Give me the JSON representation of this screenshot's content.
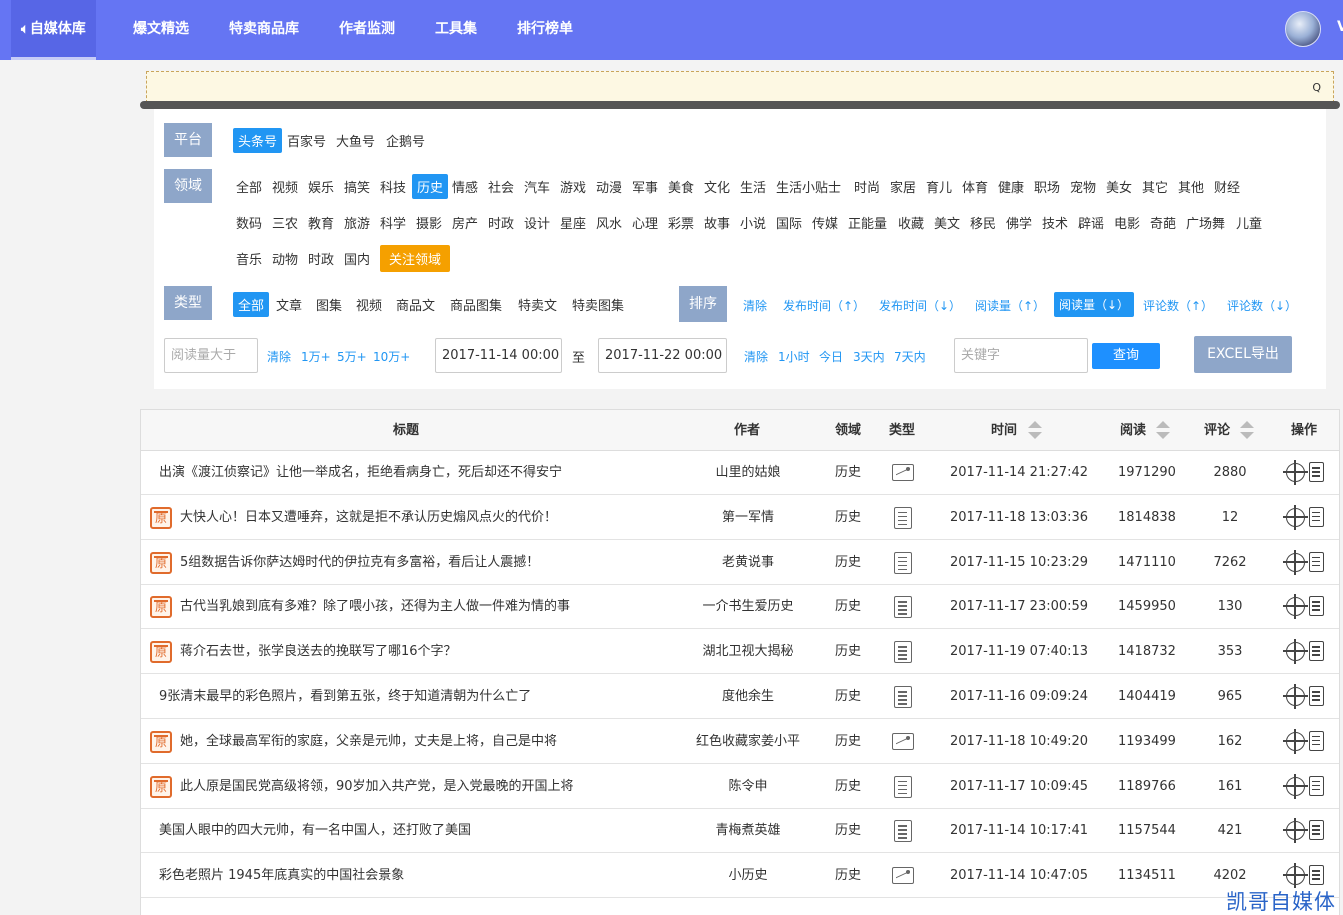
{
  "nav": {
    "brand_icon": "speaker-icon",
    "items": [
      "自媒体库",
      "爆文精选",
      "特卖商品库",
      "作者监测",
      "工具集",
      "排行榜单"
    ],
    "user_initial": "V"
  },
  "filters": {
    "platform_label": "平台",
    "platforms": [
      "头条号",
      "百家号",
      "大鱼号",
      "企鹅号"
    ],
    "domain_label": "领域",
    "domains_row1": [
      "全部",
      "视频",
      "娱乐",
      "搞笑",
      "科技",
      "历史",
      "情感",
      "社会",
      "汽车",
      "游戏",
      "动漫",
      "军事",
      "美食",
      "文化",
      "生活",
      "生活小贴士",
      "时尚",
      "家居",
      "育儿",
      "体育",
      "健康",
      "职场",
      "宠物",
      "美女",
      "其它",
      "其他",
      "财经"
    ],
    "domains_row2": [
      "数码",
      "三农",
      "教育",
      "旅游",
      "科学",
      "摄影",
      "房产",
      "时政",
      "设计",
      "星座",
      "风水",
      "心理",
      "彩票",
      "故事",
      "小说",
      "国际",
      "传媒",
      "正能量",
      "收藏",
      "美文",
      "移民",
      "佛学",
      "技术",
      "辟谣",
      "电影",
      "奇葩",
      "广场舞",
      "儿童"
    ],
    "domains_row3": [
      "音乐",
      "动物",
      "时政",
      "国内"
    ],
    "follow_domain": "关注领域",
    "type_label": "类型",
    "types": [
      "全部",
      "文章",
      "图集",
      "视频",
      "商品文",
      "商品图集",
      "特卖文",
      "特卖图集"
    ],
    "sort_label": "排序",
    "sorts": [
      "清除",
      "发布时间（↑）",
      "发布时间（↓）",
      "阅读量（↑）",
      "阅读量（↓）",
      "评论数（↑）",
      "评论数（↓）"
    ],
    "read_placeholder": "阅读量大于",
    "read_quick": [
      "清除",
      "1万+",
      "5万+",
      "10万+"
    ],
    "date_from": "2017-11-14 00:00",
    "date_to_label": "至",
    "date_to": "2017-11-22 00:00",
    "time_quick": [
      "清除",
      "1小时",
      "今日",
      "3天内",
      "7天内"
    ],
    "keyword_placeholder": "关键字",
    "query_button": "查询",
    "excel_button": "EXCEL导出"
  },
  "table": {
    "headers": [
      "标题",
      "作者",
      "领域",
      "类型",
      "时间",
      "阅读",
      "评论",
      "操作"
    ],
    "rows": [
      {
        "original": false,
        "title": "出演《渡江侦察记》让他一举成名，拒绝看病身亡，死后却还不得安宁",
        "author": "山里的姑娘",
        "domain": "历史",
        "type": "image",
        "time": "2017-11-14 21:27:42",
        "reads": "1971290",
        "comments": "2880"
      },
      {
        "original": true,
        "title": "大快人心！日本又遭唾弃，这就是拒不承认历史煽风点火的代价！",
        "author": "第一军情",
        "domain": "历史",
        "type": "doc",
        "time": "2017-11-18 13:03:36",
        "reads": "1814838",
        "comments": "12"
      },
      {
        "original": true,
        "title": "5组数据告诉你萨达姆时代的伊拉克有多富裕，看后让人震撼！",
        "author": "老黄说事",
        "domain": "历史",
        "type": "doc",
        "time": "2017-11-15 10:23:29",
        "reads": "1471110",
        "comments": "7262"
      },
      {
        "original": true,
        "title": "古代当乳娘到底有多难？除了喂小孩，还得为主人做一件难为情的事",
        "author": "一介书生爱历史",
        "domain": "历史",
        "type": "doc",
        "time": "2017-11-17 23:00:59",
        "reads": "1459950",
        "comments": "130"
      },
      {
        "original": true,
        "title": "蒋介石去世，张学良送去的挽联写了哪16个字？",
        "author": "湖北卫视大揭秘",
        "domain": "历史",
        "type": "doc",
        "time": "2017-11-19 07:40:13",
        "reads": "1418732",
        "comments": "353"
      },
      {
        "original": false,
        "title": "9张清末最早的彩色照片，看到第五张，终于知道清朝为什么亡了",
        "author": "度他余生",
        "domain": "历史",
        "type": "doc",
        "time": "2017-11-16 09:09:24",
        "reads": "1404419",
        "comments": "965"
      },
      {
        "original": true,
        "title": "她，全球最高军衔的家庭，父亲是元帅，丈夫是上将，自己是中将",
        "author": "红色收藏家姜小平",
        "domain": "历史",
        "type": "image",
        "time": "2017-11-18 10:49:20",
        "reads": "1193499",
        "comments": "162"
      },
      {
        "original": true,
        "title": "此人原是国民党高级将领，90岁加入共产党，是入党最晚的开国上将",
        "author": "陈令申",
        "domain": "历史",
        "type": "doc",
        "time": "2017-11-17 10:09:45",
        "reads": "1189766",
        "comments": "161"
      },
      {
        "original": false,
        "title": "美国人眼中的四大元帅，有一名中国人，还打败了美国",
        "author": "青梅煮英雄",
        "domain": "历史",
        "type": "doc",
        "time": "2017-11-14 10:17:41",
        "reads": "1157544",
        "comments": "421"
      },
      {
        "original": false,
        "title": "彩色老照片 1945年底真实的中国社会景象",
        "author": "小历史",
        "domain": "历史",
        "type": "image",
        "time": "2017-11-14 10:47:05",
        "reads": "1134511",
        "comments": "4202"
      }
    ],
    "original_badge": "原"
  },
  "watermark": "凯哥自媒体"
}
